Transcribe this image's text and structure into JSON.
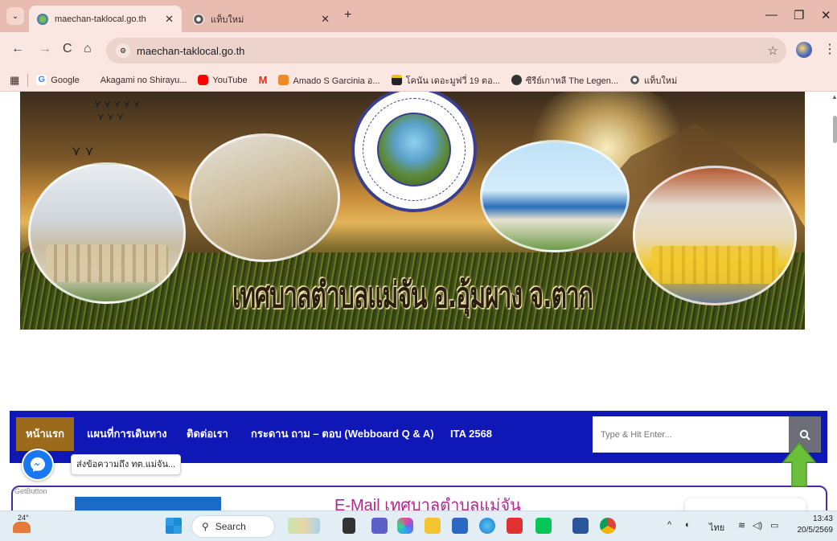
{
  "browser": {
    "tabs": [
      {
        "title": "maechan-taklocal.go.th",
        "active": true
      },
      {
        "title": "แท็บใหม่",
        "active": false
      }
    ],
    "url": "maechan-taklocal.go.th",
    "bookmarks": [
      {
        "label": "Google",
        "icon": "google-icon"
      },
      {
        "label": "Akagami no Shirayu...",
        "icon": "page-icon"
      },
      {
        "label": "YouTube",
        "icon": "youtube-icon"
      },
      {
        "label": "",
        "icon": "gmail-icon"
      },
      {
        "label": "Amado S Garcinia อ...",
        "icon": "amado-icon"
      },
      {
        "label": "โคนัน เดอะมูฟวี่ 19 ตอ...",
        "icon": "movie-icon"
      },
      {
        "label": "ซีรีย์เกาหลี The Legen...",
        "icon": "web-icon"
      },
      {
        "label": "แท็บใหม่",
        "icon": "chrome-icon"
      }
    ],
    "colors": {
      "tabstrip": "#e9bcb2",
      "toolbar": "#fbe7e2"
    }
  },
  "banner": {
    "title": "เทศบาลตำบลแม่จัน อ.อุ้มผาง จ.ตาก"
  },
  "nav": {
    "items": [
      "หน้าแรก",
      "แผนที่การเดินทาง",
      "ติดต่อเรา",
      "กระดาน ถาม – ตอบ (Webboard Q & A)",
      "ITA 2568"
    ],
    "active_index": 0,
    "search_placeholder": "Type & Hit Enter...",
    "colors": {
      "bar": "#0f17b6",
      "active": "#9b6a1a"
    }
  },
  "messenger": {
    "bubble_text": "ส่งข้อความถึง ทต.แม่จัน...",
    "getbutton_label": "GetButton"
  },
  "content": {
    "email_heading": "E-Mail เทศบาลตำบลแม่จัน"
  },
  "taskbar": {
    "weather_temp": "24°",
    "search_label": "Search",
    "language": "ไทย",
    "time": "13:43",
    "date": "20/5/2569"
  }
}
